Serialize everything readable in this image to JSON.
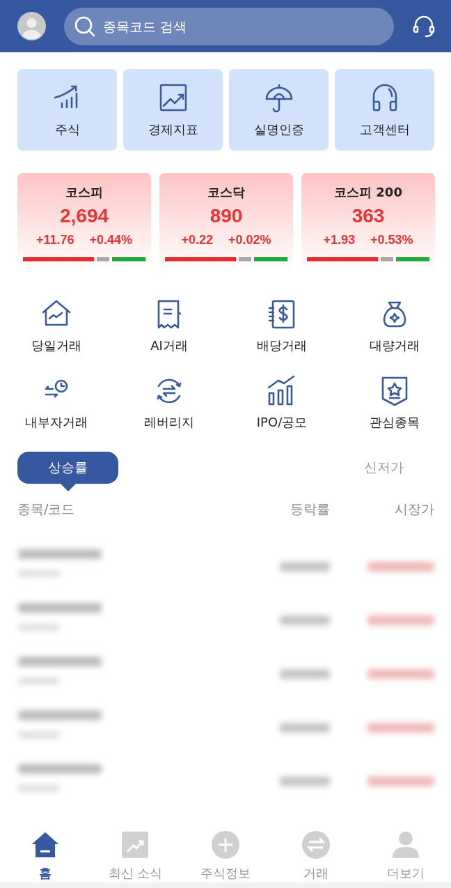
{
  "header": {
    "search": {
      "placeholder": "종목코드 검색"
    }
  },
  "shortcuts": [
    {
      "label": "주식",
      "kind": "stocks"
    },
    {
      "label": "경제지표",
      "kind": "chart"
    },
    {
      "label": "실명인증",
      "kind": "umbrella"
    },
    {
      "label": "고객센터",
      "kind": "headphones"
    }
  ],
  "indices": [
    {
      "name": "코스피",
      "value": "2,694",
      "change": "+11.76",
      "rate": "+0.44%",
      "level": 0.58
    },
    {
      "name": "코스닥",
      "value": "890",
      "change": "+0.22",
      "rate": "+0.02%",
      "level": 0.58
    },
    {
      "name": "코스피 200",
      "value": "363",
      "change": "+1.93",
      "rate": "+0.53%",
      "level": 0.58
    }
  ],
  "menu": [
    {
      "label": "당일거래",
      "kind": "house"
    },
    {
      "label": "AI거래",
      "kind": "receipt"
    },
    {
      "label": "배당거래",
      "kind": "dollar"
    },
    {
      "label": "대량거래",
      "kind": "bag"
    },
    {
      "label": "내부자거래",
      "kind": "clock"
    },
    {
      "label": "레버리지",
      "kind": "swap"
    },
    {
      "label": "IPO/공모",
      "kind": "bars"
    },
    {
      "label": "관심종목",
      "kind": "badge"
    }
  ],
  "tabs": [
    {
      "label": "상승률",
      "selected": true
    },
    {
      "label": "신저가",
      "selected": false
    }
  ],
  "table": {
    "columns": [
      "종목/코드",
      "등락률",
      "시장가"
    ],
    "rows": [
      {
        "kind": "blurred"
      },
      {
        "kind": "blurred"
      },
      {
        "kind": "blurred"
      },
      {
        "kind": "blurred"
      },
      {
        "kind": "blurred"
      }
    ]
  },
  "nav": [
    {
      "label": "홈",
      "kind": "home",
      "selected": true
    },
    {
      "label": "최신 소식",
      "kind": "news",
      "selected": false
    },
    {
      "label": "주식정보",
      "kind": "plus",
      "selected": false
    },
    {
      "label": "거래",
      "kind": "swap",
      "selected": false
    },
    {
      "label": "더보기",
      "kind": "person",
      "selected": false
    }
  ]
}
